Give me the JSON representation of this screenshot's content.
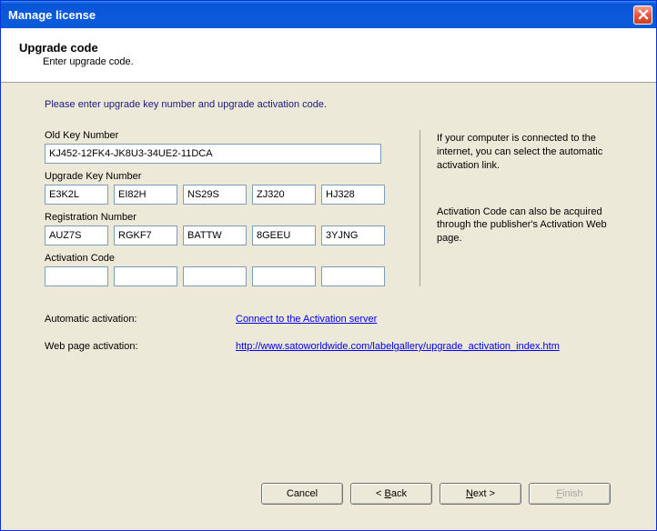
{
  "window": {
    "title": "Manage license"
  },
  "header": {
    "title": "Upgrade code",
    "subtitle": "Enter upgrade code."
  },
  "instruction": "Please enter upgrade key number and upgrade activation code.",
  "fields": {
    "old_key_label": "Old Key Number",
    "old_key_value": "KJ452-12FK4-JK8U3-34UE2-11DCA",
    "upgrade_key_label": "Upgrade Key Number",
    "upgrade_key": [
      "E3K2L",
      "EI82H",
      "NS29S",
      "ZJ320",
      "HJ328"
    ],
    "registration_label": "Registration Number",
    "registration": [
      "AUZ7S",
      "RGKF7",
      "BATTW",
      "8GEEU",
      "3YJNG"
    ],
    "activation_label": "Activation Code",
    "activation": [
      "",
      "",
      "",
      "",
      ""
    ]
  },
  "info": {
    "para1": "If your computer is connected to the internet, you can select the automatic activation link.",
    "para2": "Activation Code can also be acquired through the publisher's Activation Web page."
  },
  "links": {
    "auto_label": "Automatic activation:",
    "auto_link": "Connect to the Activation server",
    "web_label": "Web page activation:",
    "web_link": "http://www.satoworldwide.com/labelgallery/upgrade_activation_index.htm"
  },
  "buttons": {
    "cancel": "Cancel",
    "back_prefix": "< ",
    "back_u": "B",
    "back_rest": "ack",
    "next_u": "N",
    "next_rest": "ext >",
    "finish_u": "F",
    "finish_rest": "inish"
  }
}
